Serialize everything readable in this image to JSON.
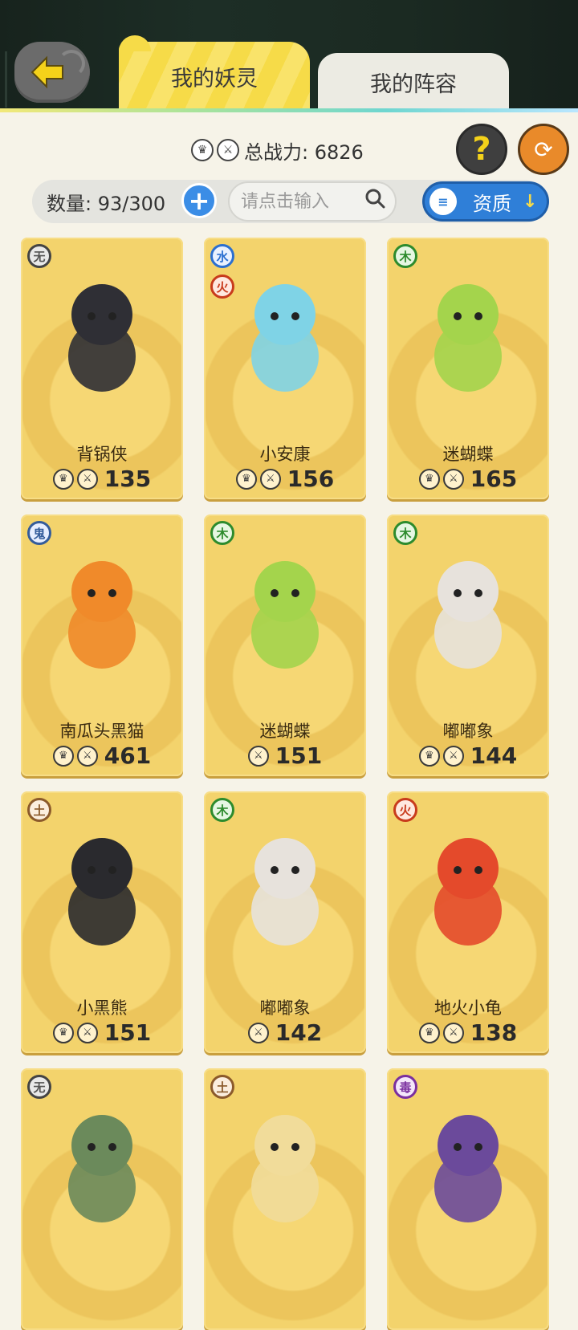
{
  "header": {
    "back_icon": "back-arrow-icon",
    "tabs": [
      {
        "label": "我的妖灵",
        "active": true
      },
      {
        "label": "我的阵容",
        "active": false
      }
    ]
  },
  "summary": {
    "total_power_label": "总战力: 6826",
    "help_icon": "question-mark-icon",
    "refresh_icon": "refresh-icon"
  },
  "filter": {
    "count_label": "数量: 93/300",
    "search_placeholder": "请点击输入",
    "search_value": "",
    "sort_label": "资质"
  },
  "cards": [
    {
      "elements": [
        "无"
      ],
      "name": "背锅侠",
      "power": "135",
      "icons": [
        "crown-icon",
        "sword-icon"
      ]
    },
    {
      "elements": [
        "水",
        "火"
      ],
      "name": "小安康",
      "power": "156",
      "icons": [
        "crown-icon",
        "sword-icon"
      ]
    },
    {
      "elements": [
        "木"
      ],
      "name": "迷蝴蝶",
      "power": "165",
      "icons": [
        "crown-icon",
        "sword-icon"
      ]
    },
    {
      "elements": [
        "鬼"
      ],
      "name": "南瓜头黑猫",
      "power": "461",
      "icons": [
        "crown-icon",
        "sword-icon"
      ]
    },
    {
      "elements": [
        "木"
      ],
      "name": "迷蝴蝶",
      "power": "151",
      "icons": [
        "sword-icon"
      ]
    },
    {
      "elements": [
        "木"
      ],
      "name": "嘟嘟象",
      "power": "144",
      "icons": [
        "crown-icon",
        "sword-icon"
      ]
    },
    {
      "elements": [
        "土"
      ],
      "name": "小黑熊",
      "power": "151",
      "icons": [
        "crown-icon",
        "sword-icon"
      ]
    },
    {
      "elements": [
        "木"
      ],
      "name": "嘟嘟象",
      "power": "142",
      "icons": [
        "sword-icon"
      ]
    },
    {
      "elements": [
        "火"
      ],
      "name": "地火小龟",
      "power": "138",
      "icons": [
        "crown-icon",
        "sword-icon"
      ]
    },
    {
      "elements": [
        "无"
      ],
      "name": "",
      "power": "",
      "icons": []
    },
    {
      "elements": [
        "土"
      ],
      "name": "",
      "power": "",
      "icons": []
    },
    {
      "elements": [
        "毒"
      ],
      "name": "",
      "power": "",
      "icons": []
    }
  ]
}
